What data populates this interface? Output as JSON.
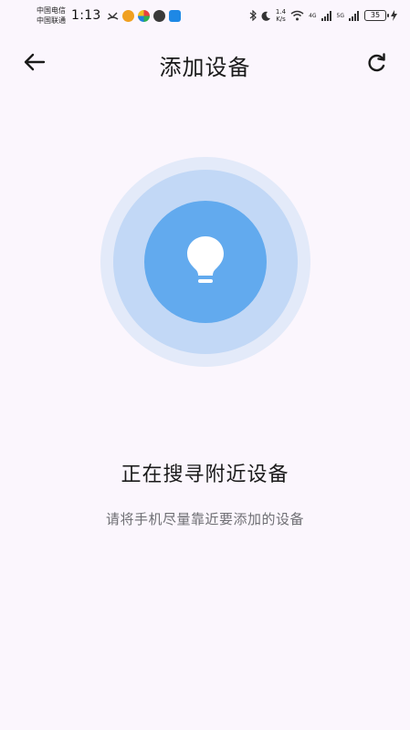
{
  "status_bar": {
    "carrier_1": "中国电信",
    "carrier_2": "中国联通",
    "time": "1:13",
    "net_speed_value": "1.4",
    "net_speed_unit": "K/s",
    "signal_1_label": "4G",
    "signal_2_label": "5G",
    "battery": "35"
  },
  "header": {
    "title": "添加设备"
  },
  "main": {
    "status_text": "正在搜寻附近设备",
    "hint_text": "请将手机尽量靠近要添加的设备"
  },
  "colors": {
    "background": "#fbf6fd",
    "ring_outer": "#e3eaf9",
    "ring_mid": "#c2d8f6",
    "ring_inner": "#62aaee"
  }
}
